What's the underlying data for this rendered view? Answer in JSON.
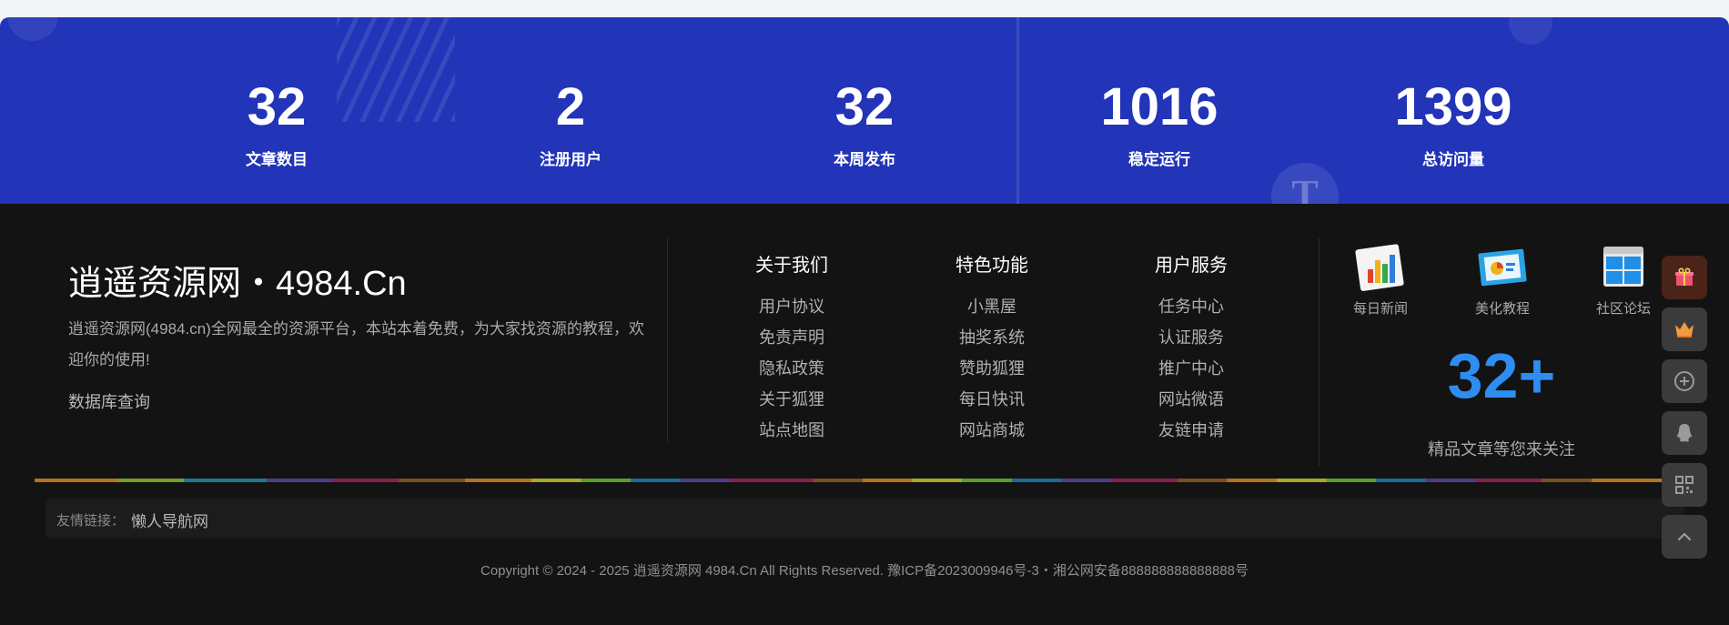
{
  "stats": [
    {
      "value": "32",
      "label": "文章数目"
    },
    {
      "value": "2",
      "label": "注册用户"
    },
    {
      "value": "32",
      "label": "本周发布"
    },
    {
      "value": "1016",
      "label": "稳定运行"
    },
    {
      "value": "1399",
      "label": "总访问量"
    }
  ],
  "site": {
    "title": "逍遥资源网・4984.Cn",
    "description": "逍遥资源网(4984.cn)全网最全的资源平台，本站本着免费，为大家找资源的教程，欢迎你的使用!",
    "db_link": "数据库查询"
  },
  "link_columns": [
    {
      "title": "关于我们",
      "items": [
        "用户协议",
        "免责声明",
        "隐私政策",
        "关于狐狸",
        "站点地图"
      ]
    },
    {
      "title": "特色功能",
      "items": [
        "小黑屋",
        "抽奖系统",
        "赞助狐狸",
        "每日快讯",
        "网站商城"
      ]
    },
    {
      "title": "用户服务",
      "items": [
        "任务中心",
        "认证服务",
        "推广中心",
        "网站微语",
        "友链申请"
      ]
    }
  ],
  "apps": [
    {
      "icon": "bar-chart-icon",
      "label": "每日新闻"
    },
    {
      "icon": "presentation-icon",
      "label": "美化教程"
    },
    {
      "icon": "windows-icon",
      "label": "社区论坛"
    }
  ],
  "promo": {
    "count": "32+",
    "caption": "精品文章等您来关注"
  },
  "friend_links": {
    "label": "友情链接：",
    "links": [
      "懒人导航网"
    ]
  },
  "copyright": "Copyright © 2024 - 2025 逍遥资源网 4984.Cn All Rights Reserved. 豫ICP备2023009946号-3・湘公网安备888888888888888号",
  "float_buttons": [
    "gift-icon",
    "crown-icon",
    "plus-circle-icon",
    "qq-icon",
    "qr-code-icon",
    "back-to-top-icon"
  ],
  "colors": {
    "stats_bg": "#2234b8",
    "footer_bg": "#131313",
    "accent_blue": "#2f8df1"
  }
}
